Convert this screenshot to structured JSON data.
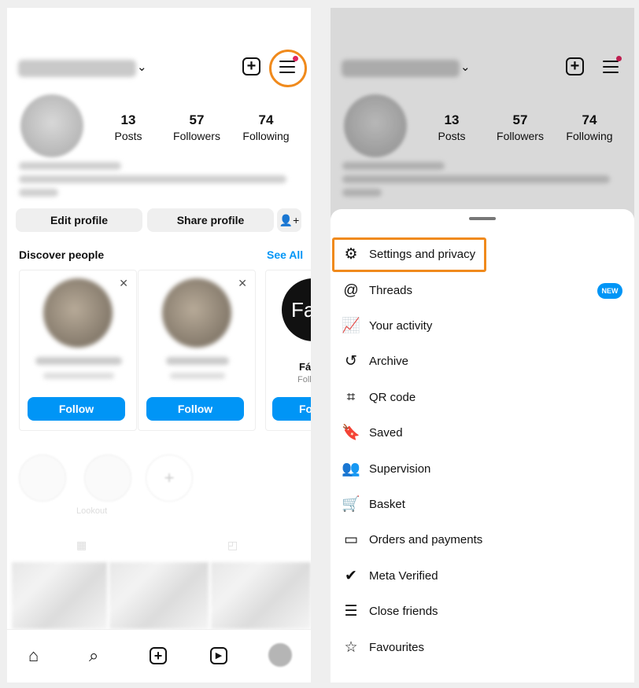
{
  "left": {
    "stats": [
      {
        "value": "13",
        "label": "Posts"
      },
      {
        "value": "57",
        "label": "Followers"
      },
      {
        "value": "74",
        "label": "Following"
      }
    ],
    "edit_profile": "Edit profile",
    "share_profile": "Share profile",
    "discover_title": "Discover people",
    "see_all": "See All",
    "follow": "Follow",
    "card3_name": "Fát",
    "card3_sub": "Follo",
    "card3_badge": "Fa",
    "highlight_label": "Lookout"
  },
  "right": {
    "stats": [
      {
        "value": "13",
        "label": "Posts"
      },
      {
        "value": "57",
        "label": "Followers"
      },
      {
        "value": "74",
        "label": "Following"
      }
    ],
    "menu": [
      {
        "icon": "gear-icon",
        "label": "Settings and privacy"
      },
      {
        "icon": "threads-icon",
        "label": "Threads"
      },
      {
        "icon": "activity-icon",
        "label": "Your activity"
      },
      {
        "icon": "archive-icon",
        "label": "Archive"
      },
      {
        "icon": "qr-code-icon",
        "label": "QR code"
      },
      {
        "icon": "bookmark-icon",
        "label": "Saved"
      },
      {
        "icon": "supervision-icon",
        "label": "Supervision"
      },
      {
        "icon": "cart-icon",
        "label": "Basket"
      },
      {
        "icon": "card-icon",
        "label": "Orders and payments"
      },
      {
        "icon": "verified-icon",
        "label": "Meta Verified"
      },
      {
        "icon": "list-icon",
        "label": "Close friends"
      },
      {
        "icon": "star-icon",
        "label": "Favourites"
      }
    ],
    "new_badge": "NEW"
  },
  "colors": {
    "accent": "#0095f6",
    "highlight": "#f08a1c",
    "notification": "#e0245e"
  }
}
